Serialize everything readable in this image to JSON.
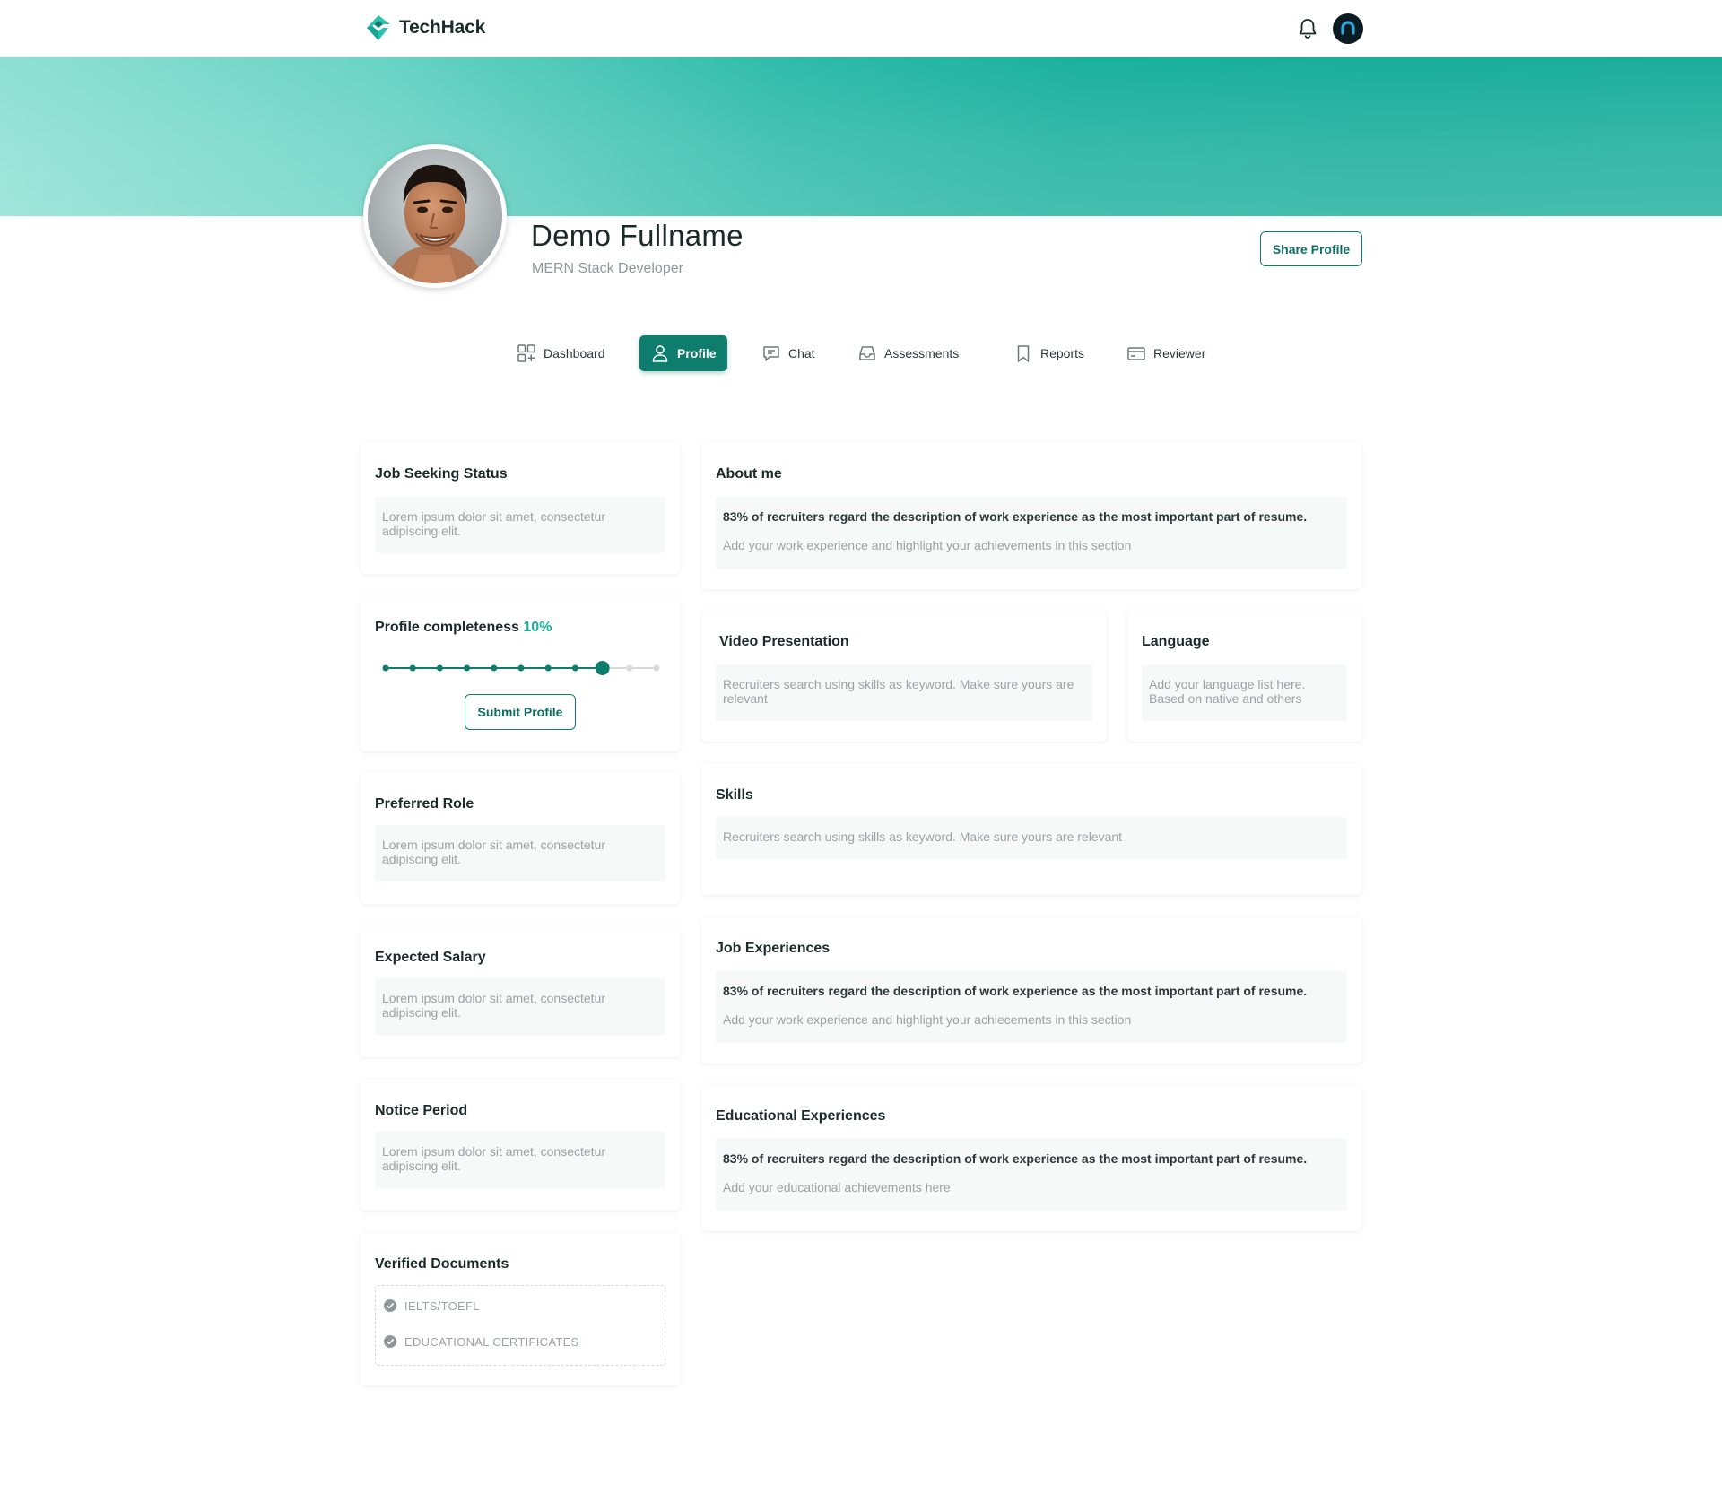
{
  "brand": {
    "name": "TechHack"
  },
  "profile": {
    "name": "Demo Fullname",
    "role": "MERN Stack Developer",
    "share_label": "Share Profile"
  },
  "tabs": [
    {
      "label": "Dashboard",
      "icon": "dashboard-icon",
      "active": false
    },
    {
      "label": "Profile",
      "icon": "user-icon",
      "active": true
    },
    {
      "label": "Chat",
      "icon": "chat-icon",
      "active": false
    },
    {
      "label": "Assessments",
      "icon": "inbox-icon",
      "active": false
    },
    {
      "label": "Reports",
      "icon": "bookmark-icon",
      "active": false
    },
    {
      "label": "Reviewer",
      "icon": "card-icon",
      "active": false
    }
  ],
  "left_cards": {
    "job_seeking": {
      "title": "Job Seeking Status",
      "text": "Lorem ipsum dolor sit amet, consectetur adipiscing elit."
    },
    "completeness": {
      "title": "Profile completeness",
      "percent": "10%",
      "steps_total": 11,
      "steps_done": 9,
      "submit_label": "Submit Profile"
    },
    "preferred_role": {
      "title": "Preferred Role",
      "text": "Lorem ipsum dolor sit amet, consectetur adipiscing elit."
    },
    "expected_salary": {
      "title": "Expected Salary",
      "text": "Lorem ipsum dolor sit amet, consectetur adipiscing elit."
    },
    "notice_period": {
      "title": "Notice Period",
      "text": "Lorem ipsum dolor sit amet, consectetur adipiscing elit."
    },
    "verified_docs": {
      "title": "Verified Documents",
      "items": [
        "IELTS/TOEFL",
        "EDUCATIONAL CERTIFICATES"
      ]
    }
  },
  "right_cards": {
    "about": {
      "title": "About me",
      "strong": "83% of recruiters regard the description of work experience as the most important part of resume.",
      "text": "Add your work experience and highlight your achievements in this section"
    },
    "video": {
      "title": "Video Presentation",
      "text": "Recruiters search using skills as keyword. Make sure yours are relevant"
    },
    "language": {
      "title": "Language",
      "text": "Add your language list here. Based on native and others"
    },
    "skills": {
      "title": "Skills",
      "text": "Recruiters search using skills as keyword. Make sure yours are relevant"
    },
    "job_exp": {
      "title": "Job Experiences",
      "strong": "83% of recruiters regard the description of work experience as the most important part of resume.",
      "text": "Add your work experience and highlight your achiecements in this section"
    },
    "edu_exp": {
      "title": "Educational Experiences",
      "strong": "83% of recruiters regard the description of work experience as the most important part of resume.",
      "text": "Add your educational achievements here"
    }
  },
  "colors": {
    "accent": "#0f7d6e",
    "percent": "#18b2a4",
    "banner_start": "#8ee0d3",
    "banner_end": "#1cae9c"
  }
}
